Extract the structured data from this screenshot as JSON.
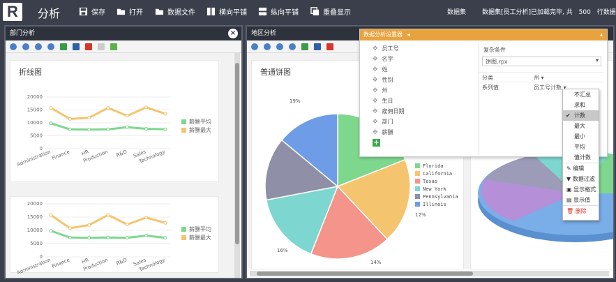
{
  "app": {
    "logo": "R",
    "title": "分析"
  },
  "toolbar": {
    "save": "保存",
    "open": "打开",
    "data_file": "数据文件",
    "tile_h": "横向平铺",
    "tile_v": "纵向平铺",
    "overlay": "重叠显示",
    "dataset_label": "数据集",
    "dataset_status_prefix": "数据集[员工分析]已加载完毕, 共",
    "dataset_count": "500",
    "dataset_status_suffix": "行数据"
  },
  "left_panel": {
    "title": "部门分析",
    "close": "×",
    "card1_title": "折线图",
    "legend": [
      "薪酬平均",
      "薪酬最大"
    ]
  },
  "right_panel": {
    "title": "地区分析",
    "pie_title": "普通饼图",
    "pie_labels": [
      "19%",
      "16%",
      "14%",
      "12%"
    ],
    "legend": [
      "Florida",
      "California",
      "Texas",
      "New York",
      "Pennsylvania",
      "Illinois"
    ]
  },
  "config": {
    "title": "数据分析设置器",
    "fields": [
      "员工号",
      "名字",
      "姓",
      "性别",
      "州",
      "生日",
      "雇佣日期",
      "部门",
      "薪酬"
    ],
    "add": "+",
    "filter_label": "复杂条件",
    "file_value": "饼图.rpx",
    "category_label": "分类",
    "category_value": "州",
    "series_label": "系列值",
    "series_value": "员工号计数"
  },
  "menu": {
    "items": [
      "不汇总",
      "求和",
      "计数",
      "最大",
      "最小",
      "平均",
      "值计数"
    ],
    "active_index": 2,
    "actions": [
      "编辑",
      "数据过滤",
      "显示格式",
      "显示值"
    ],
    "delete": "删除"
  },
  "chart_data": [
    {
      "type": "line",
      "categories": [
        "Administration",
        "Finance",
        "HR",
        "Production",
        "R&D",
        "Sales",
        "Technology"
      ],
      "series": [
        {
          "name": "薪酬平均",
          "values": [
            9800,
            7500,
            7400,
            7500,
            8300,
            7700,
            7500
          ],
          "color": "#7dd88e"
        },
        {
          "name": "薪酬最大",
          "values": [
            15800,
            11500,
            12000,
            15800,
            12700,
            16000,
            13500
          ],
          "color": "#f5c46e"
        }
      ],
      "ylim": [
        0,
        20000
      ],
      "yticks": [
        "0",
        "5000",
        "10000",
        "15000",
        "20000"
      ],
      "legend": "right"
    },
    {
      "type": "line",
      "categories": [
        "Administration",
        "Finance",
        "HR",
        "Production",
        "R&D",
        "Sales",
        "Technology"
      ],
      "series": [
        {
          "name": "薪酬平均",
          "values": [
            9800,
            7300,
            7200,
            7300,
            7200,
            8000,
            7200
          ],
          "color": "#7dd88e"
        },
        {
          "name": "薪酬最大",
          "values": [
            15800,
            10800,
            12000,
            15800,
            12200,
            14800,
            12800
          ],
          "color": "#f5c46e"
        }
      ],
      "ylim": [
        0,
        20000
      ],
      "yticks": [
        "0",
        "5000",
        "10000",
        "15000",
        "20000"
      ],
      "legend": "right"
    },
    {
      "type": "pie",
      "slices": [
        {
          "name": "Florida",
          "value": 19,
          "color": "#7dd88e"
        },
        {
          "name": "California",
          "value": 19,
          "color": "#f5c46e"
        },
        {
          "name": "Texas",
          "value": 18,
          "color": "#f4948a"
        },
        {
          "name": "New York",
          "value": 16,
          "color": "#7dd6cf"
        },
        {
          "name": "Pennsylvania",
          "value": 14,
          "color": "#8f8fa8"
        },
        {
          "name": "Illinois",
          "value": 14,
          "color": "#6f9ce6"
        }
      ]
    }
  ]
}
